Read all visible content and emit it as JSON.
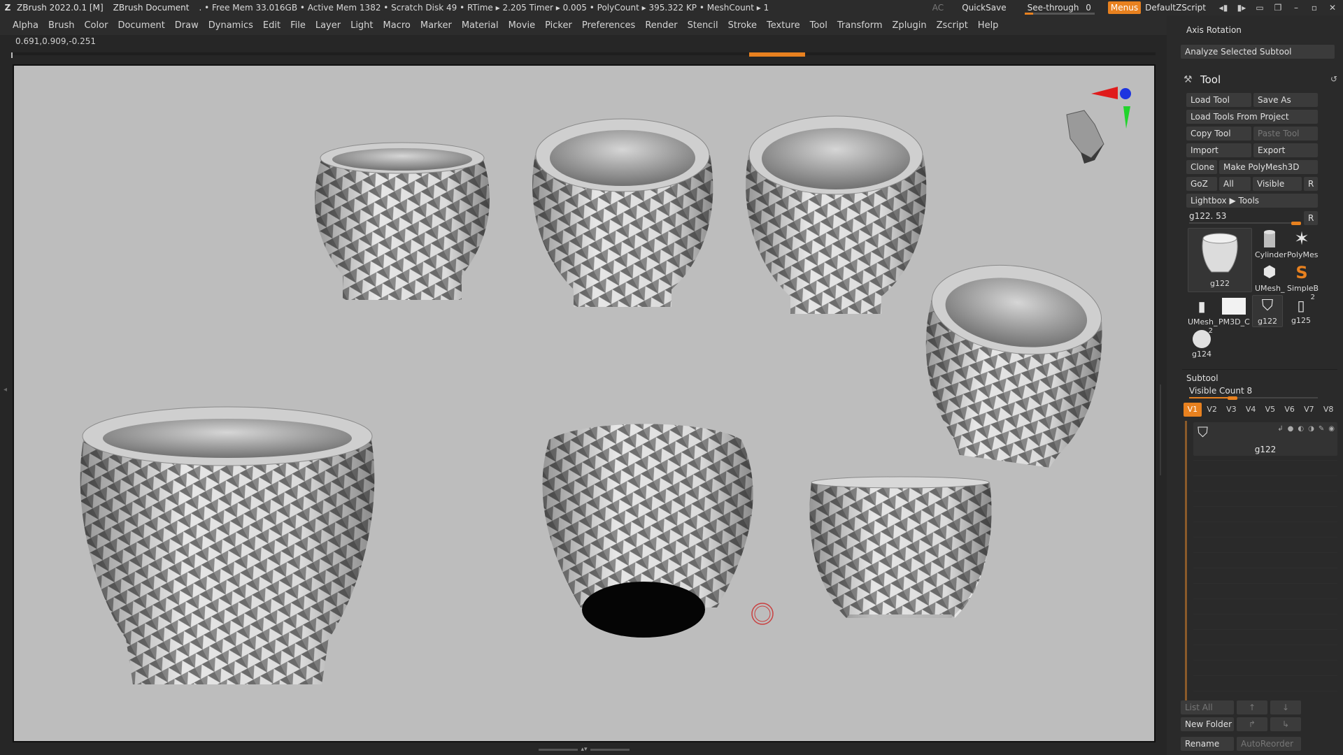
{
  "titlebar": {
    "app": "ZBrush 2022.0.1 [M]",
    "document": "ZBrush Document",
    "stats": ". • Free Mem 33.016GB • Active Mem 1382 • Scratch Disk 49 • RTime ▸ 2.205 Timer ▸ 0.005 • PolyCount ▸ 395.322 KP • MeshCount ▸ 1",
    "ac": "AC",
    "quicksave": "QuickSave",
    "see_through_label": "See-through",
    "see_through_value": "0",
    "see_through_level": 0,
    "menus": "Menus",
    "script": "DefaultZScript"
  },
  "menubar": [
    "Alpha",
    "Brush",
    "Color",
    "Document",
    "Draw",
    "Dynamics",
    "Edit",
    "File",
    "Layer",
    "Light",
    "Macro",
    "Marker",
    "Material",
    "Movie",
    "Picker",
    "Preferences",
    "Render",
    "Stencil",
    "Stroke",
    "Texture",
    "Tool",
    "Transform",
    "Zplugin",
    "Zscript",
    "Help"
  ],
  "coords": "0.691,0.909,-0.251",
  "panel": {
    "axis_rotation": "Axis Rotation",
    "analyze": "Analyze Selected Subtool",
    "tool_title": "Tool",
    "load_tool": "Load Tool",
    "save_as": "Save As",
    "load_from_project": "Load Tools From Project",
    "copy_tool": "Copy Tool",
    "paste_tool": "Paste Tool",
    "import": "Import",
    "export": "Export",
    "clone": "Clone",
    "make_polymesh": "Make PolyMesh3D",
    "goz": "GoZ",
    "all": "All",
    "visible": "Visible",
    "r": "R",
    "lightbox": "Lightbox ▶ Tools",
    "current_tool": "g122. 53",
    "thumbs": {
      "main": "g122",
      "cylinder": "Cylinder",
      "polymesh": "PolyMes",
      "umesh1": "UMesh_",
      "simpleb": "SimpleB",
      "umesh2": "UMesh_",
      "pm3d": "PM3D_C",
      "g122b": "g122",
      "g125": "g125",
      "g124": "g124",
      "badge1": "2",
      "badge2": "2"
    },
    "subtool_title": "Subtool",
    "visible_count": "Visible Count 8",
    "visible_count_level": 0.3,
    "vtabs": [
      "V1",
      "V2",
      "V3",
      "V4",
      "V5",
      "V6",
      "V7",
      "V8"
    ],
    "subtool_name": "g122",
    "list_all": "List All",
    "new_folder": "New Folder",
    "rename": "Rename",
    "auto_reorder": "AutoReorder"
  }
}
